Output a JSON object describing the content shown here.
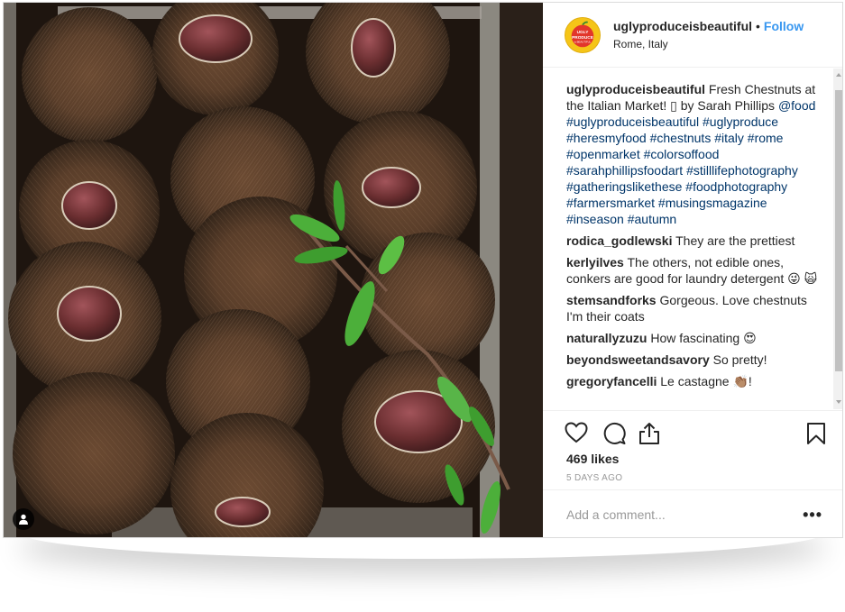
{
  "post": {
    "username": "uglyproduceisbeautiful",
    "separator": "•",
    "follow_label": "Follow",
    "location": "Rome, Italy",
    "avatar_text_top": "UGLY",
    "avatar_text_mid": "PRODUCE",
    "avatar_text_bottom": "is BEAUTIFUL"
  },
  "caption": {
    "user": "uglyproduceisbeautiful",
    "text_plain": "Fresh Chestnuts at the Italian Market! ▯ by Sarah Phillips",
    "text_tags": "@food #uglyproduceisbeautiful #uglyproduce #heresmyfood #chestnuts #italy #rome #openmarket #colorsoffood #sarahphillipsfoodart #stilllifephotography #gatheringslikethese #foodphotography #farmersmarket #musingsmagazine #inseason #autumn"
  },
  "comments": [
    {
      "user": "rodica_godlewski",
      "text": "They are the prettiest"
    },
    {
      "user": "kerlyilves",
      "text": "The others, not edible ones, conkers are good for laundry detergent 😜 🙀"
    },
    {
      "user": "stemsandforks",
      "text": "Gorgeous. Love chestnuts I'm their coats"
    },
    {
      "user": "naturallyzuzu",
      "text": "How fascinating 😍"
    },
    {
      "user": "beyondsweetandsavory",
      "text": "So pretty!"
    },
    {
      "user": "gregoryfancelli",
      "text": "Le castagne 👏🏽!"
    }
  ],
  "likes": "469 likes",
  "time_ago": "5 DAYS AGO",
  "add_comment": {
    "placeholder": "Add a comment..."
  },
  "more_label": "•••",
  "icons": {
    "like": "heart-icon",
    "comment": "comment-bubble-icon",
    "share": "share-icon",
    "save": "bookmark-icon",
    "user_tag": "person-icon"
  },
  "colors": {
    "follow": "#3897f0",
    "hashtag": "#003569",
    "muted": "#999999",
    "avatar": "#f5c518"
  }
}
